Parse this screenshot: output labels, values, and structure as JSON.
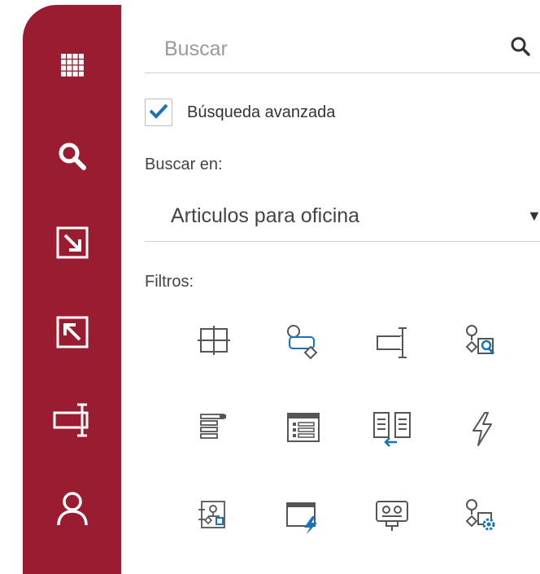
{
  "sidebar": {
    "items": [
      {
        "icon": "apps-grid-icon",
        "name": "sidebar-item-apps"
      },
      {
        "icon": "search-icon",
        "name": "sidebar-item-search"
      },
      {
        "icon": "arrow-down-right-icon",
        "name": "sidebar-item-expand"
      },
      {
        "icon": "arrow-up-left-icon",
        "name": "sidebar-item-collapse"
      },
      {
        "icon": "text-cursor-field-icon",
        "name": "sidebar-item-field"
      },
      {
        "icon": "user-icon",
        "name": "sidebar-item-user"
      }
    ],
    "color": "#9a1c31"
  },
  "search": {
    "placeholder": "Buscar",
    "value": ""
  },
  "advanced": {
    "label": "Búsqueda avanzada",
    "checked": true
  },
  "search_in": {
    "label": "Buscar en:",
    "selected": "Articulos para oficina"
  },
  "filters": {
    "label": "Filtros:",
    "icons": [
      "table-grid-icon",
      "workflow-shapes-icon",
      "text-field-icon",
      "workflow-search-icon",
      "form-list-icon",
      "list-window-icon",
      "columns-import-icon",
      "lightning-icon",
      "org-chart-icon",
      "window-action-icon",
      "device-display-icon",
      "workflow-settings-icon"
    ]
  },
  "colors": {
    "accent": "#1a73b8",
    "icon_gray": "#555555"
  }
}
